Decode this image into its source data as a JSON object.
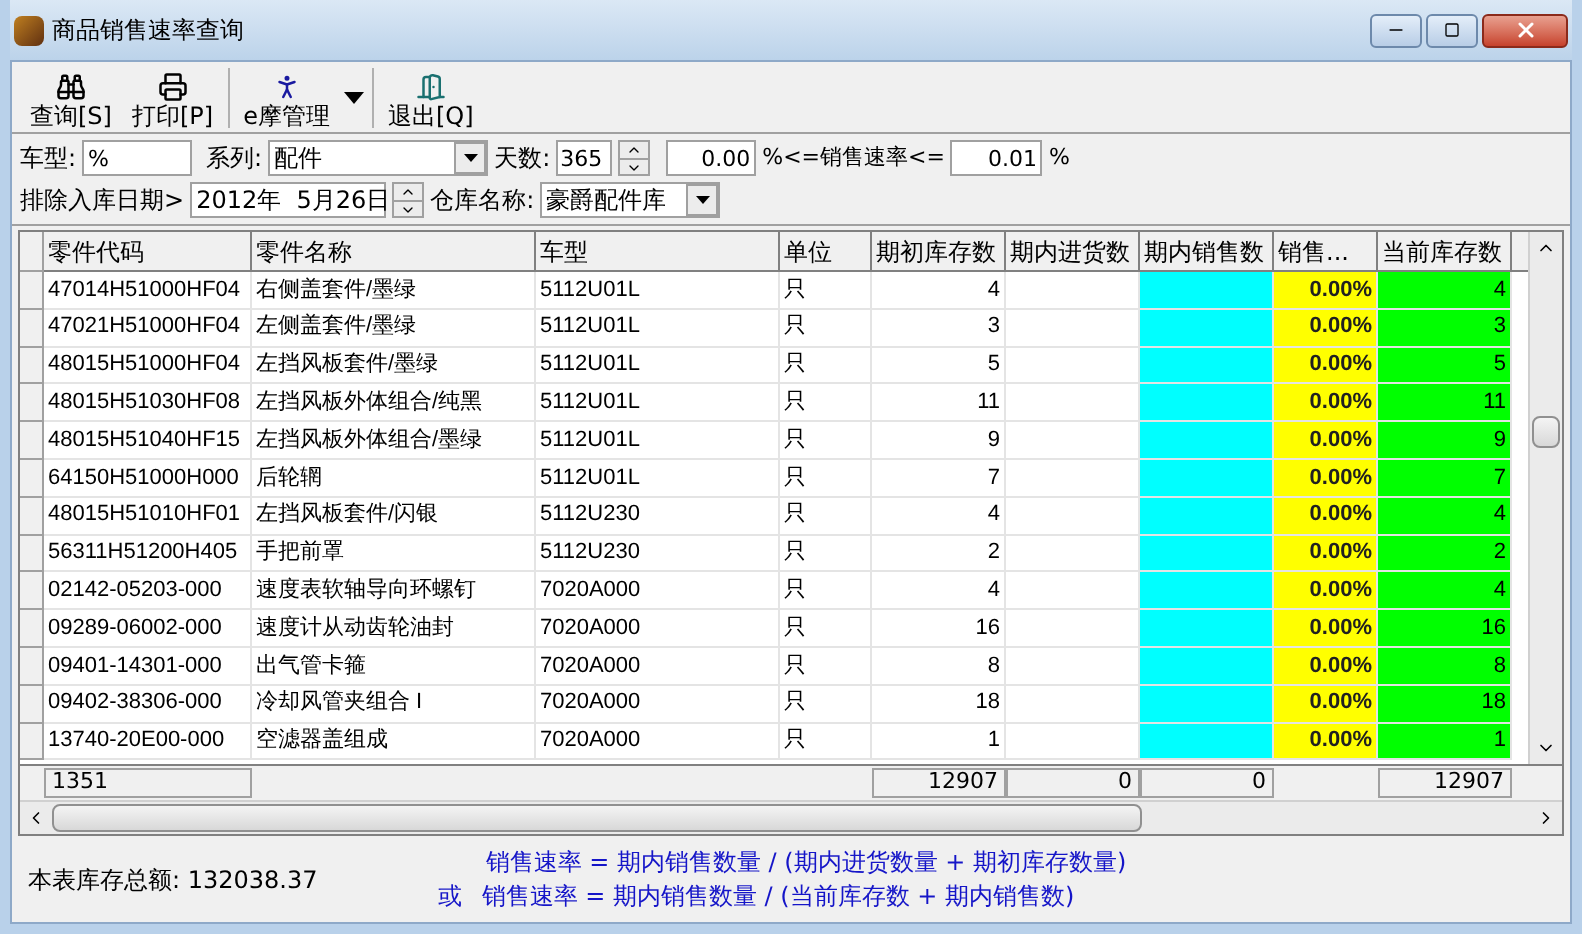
{
  "window": {
    "title": "商品销售速率查询"
  },
  "toolbar": [
    {
      "label": "查询[S]",
      "kind": "search"
    },
    {
      "label": "打印[P]",
      "kind": "print"
    },
    {
      "label": "e摩管理",
      "kind": "manage"
    },
    {
      "label": "退出[Q]",
      "kind": "exit"
    }
  ],
  "filters": {
    "model_label": "车型:",
    "model_value": "%",
    "series_label": "系列:",
    "series_value": "配件",
    "days_label": "天数:",
    "days_value": "365",
    "rate_min": "0.00",
    "rate_label": "%<=销售速率<=",
    "rate_max": "0.01",
    "rate_unit": "%",
    "date_label": "排除入库日期>",
    "date_value": "2012年  5月26日",
    "warehouse_label": "仓库名称:",
    "warehouse_value": "豪爵配件库"
  },
  "table": {
    "columns": [
      {
        "label": "零件代码"
      },
      {
        "label": "零件名称"
      },
      {
        "label": "车型"
      },
      {
        "label": "单位"
      },
      {
        "label": "期初库存数"
      },
      {
        "label": "期内进货数"
      },
      {
        "label": "期内销售数",
        "color": "#00ffff"
      },
      {
        "label": "销售...",
        "color": "#ffff00"
      },
      {
        "label": "当前库存数",
        "color": "#00ff00"
      }
    ],
    "rows": [
      {
        "code": "47014H51000HF04",
        "name": "右侧盖套件/墨绿",
        "model": "5112U01L",
        "unit": "只",
        "opening": "4",
        "rate": "0.00%",
        "current": "4"
      },
      {
        "code": "47021H51000HF04",
        "name": "左侧盖套件/墨绿",
        "model": "5112U01L",
        "unit": "只",
        "opening": "3",
        "rate": "0.00%",
        "current": "3"
      },
      {
        "code": "48015H51000HF04",
        "name": "左挡风板套件/墨绿",
        "model": "5112U01L",
        "unit": "只",
        "opening": "5",
        "rate": "0.00%",
        "current": "5"
      },
      {
        "code": "48015H51030HF08",
        "name": "左挡风板外体组合/纯黑",
        "model": "5112U01L",
        "unit": "只",
        "opening": "11",
        "rate": "0.00%",
        "current": "11"
      },
      {
        "code": "48015H51040HF15",
        "name": "左挡风板外体组合/墨绿",
        "model": "5112U01L",
        "unit": "只",
        "opening": "9",
        "rate": "0.00%",
        "current": "9"
      },
      {
        "code": "64150H51000H000",
        "name": "后轮辋",
        "model": "5112U01L",
        "unit": "只",
        "opening": "7",
        "rate": "0.00%",
        "current": "7"
      },
      {
        "code": "48015H51010HF01",
        "name": "左挡风板套件/闪银",
        "model": "5112U230",
        "unit": "只",
        "opening": "4",
        "rate": "0.00%",
        "current": "4"
      },
      {
        "code": "56311H51200H405",
        "name": "手把前罩",
        "model": "5112U230",
        "unit": "只",
        "opening": "2",
        "rate": "0.00%",
        "current": "2"
      },
      {
        "code": "02142-05203-000",
        "name": "速度表软轴导向环螺钉",
        "model": "7020A000",
        "unit": "只",
        "opening": "4",
        "rate": "0.00%",
        "current": "4"
      },
      {
        "code": "09289-06002-000",
        "name": "速度计从动齿轮油封",
        "model": "7020A000",
        "unit": "只",
        "opening": "16",
        "rate": "0.00%",
        "current": "16"
      },
      {
        "code": "09401-14301-000",
        "name": "出气管卡箍",
        "model": "7020A000",
        "unit": "只",
        "opening": "8",
        "rate": "0.00%",
        "current": "8"
      },
      {
        "code": "09402-38306-000",
        "name": "冷却风管夹组合  I",
        "model": "7020A000",
        "unit": "只",
        "opening": "18",
        "rate": "0.00%",
        "current": "18"
      },
      {
        "code": "13740-20E00-000",
        "name": "空滤器盖组成",
        "model": "7020A000",
        "unit": "只",
        "opening": "1",
        "rate": "0.00%",
        "current": "1"
      }
    ],
    "totals": {
      "count": "1351",
      "opening": "12907",
      "incoming": "0",
      "sales": "0",
      "current": "12907"
    }
  },
  "summary": {
    "stock_total": "本表库存总额: 132038.37",
    "formula_1": "销售速率 = 期内销售数量 / (期内进货数量 + 期初库存数量)",
    "formula_or": "或",
    "formula_2": "销售速率 = 期内销售数量 / (当前库存数 + 期内销售数)"
  }
}
